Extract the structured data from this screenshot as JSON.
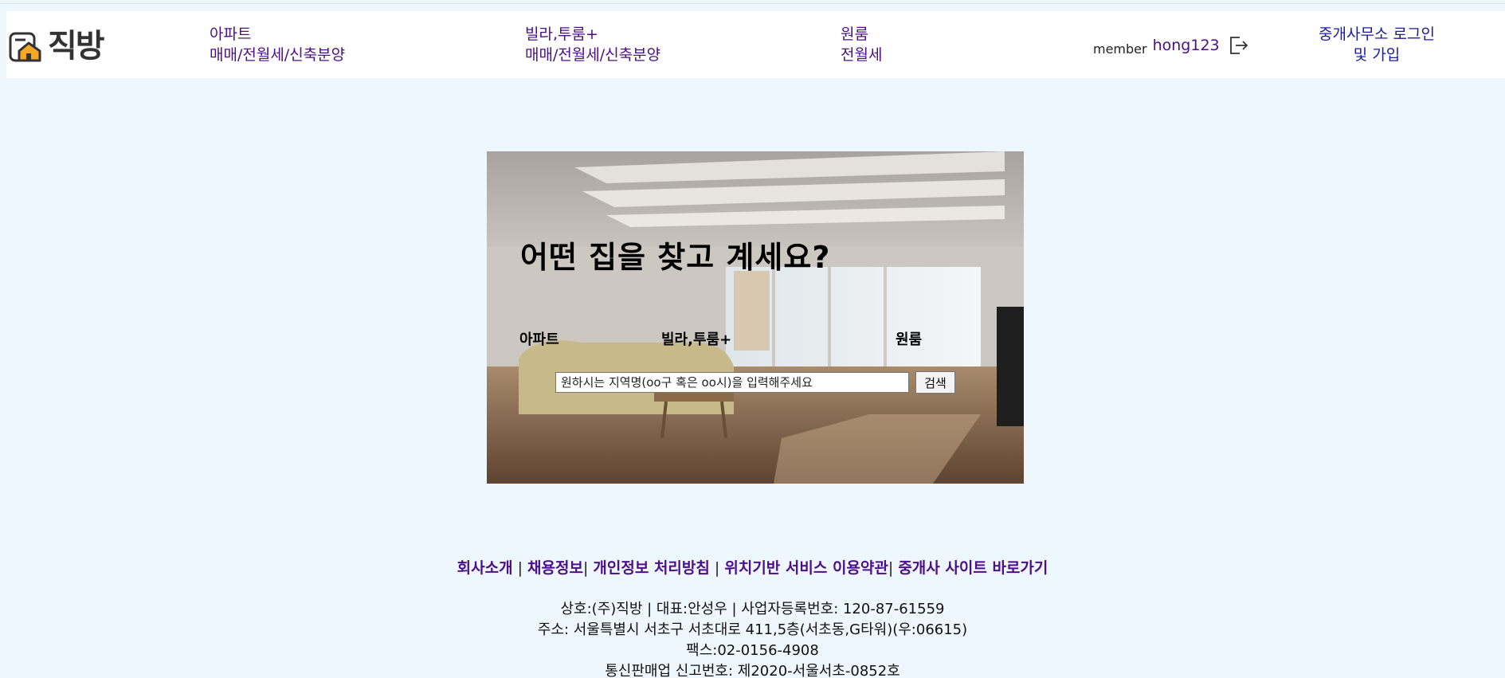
{
  "brand": {
    "logo_text": "직방"
  },
  "nav": {
    "apartment": {
      "line1": "아파트",
      "line2": "매매/전월세/신축분양"
    },
    "villa": {
      "line1": "빌라,투룸+",
      "line2": "매매/전월세/신축분양"
    },
    "oneroom": {
      "line1": "원룸",
      "line2": "전월세"
    }
  },
  "member": {
    "label": "member",
    "username": "hong123",
    "logout_icon": "logout-icon"
  },
  "agent": {
    "line1": "중개사무소 로그인",
    "line2": "및 가입"
  },
  "hero": {
    "title": "어떤 집을 찾고 계세요?",
    "tabs": [
      "아파트",
      "빌라,투룸+",
      "원룸"
    ],
    "search_placeholder": "원하시는 지역명(oo구 혹은 oo시)을 입력해주세요",
    "search_button": "검색"
  },
  "footer": {
    "links": [
      "회사소개",
      "채용정보",
      "개인정보 처리방침",
      "위치기반 서비스 이용약관",
      "중개사 사이트 바로가기"
    ],
    "seps": [
      " | ",
      "| ",
      " | ",
      "| "
    ],
    "info": [
      "상호:(주)직방 | 대표:안성우 | 사업자등록번호: 120-87-61559",
      "주소: 서울특별시 서초구 서초대로 411,5층(서초동,G타워)(우:06615)",
      "팩스:02-0156-4908",
      "통신판매업 신고번호: 제2020-서울서초-0852호"
    ]
  },
  "colors": {
    "background": "#eef6fe",
    "nav_text": "#4b0f88",
    "agent_text": "#1a1aa8",
    "header_bg": "#ffffff"
  }
}
